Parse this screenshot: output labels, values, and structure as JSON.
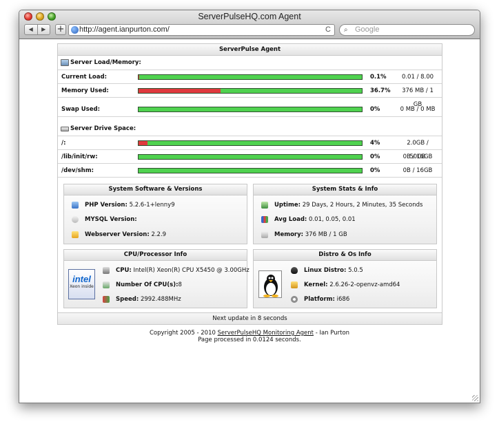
{
  "window": {
    "title": "ServerPulseHQ.com Agent"
  },
  "toolbar": {
    "back": "◀",
    "forward": "▶",
    "new_tab": "+"
  },
  "address_bar": {
    "url": "http://agent.ianpurton.com/",
    "reload": "C"
  },
  "search_bar": {
    "placeholder": "Google"
  },
  "panel": {
    "title": "ServerPulse Agent",
    "load_section": "Server Load/Memory:",
    "rows": [
      {
        "label": "Current Load:",
        "percent": "0.1%",
        "amount": "0.01 / 8.00",
        "fraction": 0.001
      },
      {
        "label": "Memory Used:",
        "percent": "36.7%",
        "amount": "376 MB / 1 GB",
        "fraction": 0.367
      },
      {
        "label": "Swap Used:",
        "percent": "0%",
        "amount": "0 MB / 0 MB",
        "fraction": 0
      }
    ],
    "drive_section": "Server Drive Space:",
    "drives": [
      {
        "label": "/:",
        "percent": "4%",
        "amount": "2.0GB / 50GB",
        "fraction": 0.04
      },
      {
        "label": "/lib/init/rw:",
        "percent": "0%",
        "amount": "0B / 16GB",
        "fraction": 0
      },
      {
        "label": "/dev/shm:",
        "percent": "0%",
        "amount": "0B / 16GB",
        "fraction": 0
      }
    ],
    "software": {
      "title": "System Software & Versions",
      "items": [
        {
          "label": "PHP Version:",
          "value": "5.2.6-1+lenny9"
        },
        {
          "label": "MYSQL Version:",
          "value": ""
        },
        {
          "label": "Webserver Version:",
          "value": "2.2.9"
        }
      ]
    },
    "stats": {
      "title": "System Stats & Info",
      "items": [
        {
          "label": "Uptime:",
          "value": "29 Days, 2 Hours, 2 Minutes, 35 Seconds"
        },
        {
          "label": "Avg Load:",
          "value": "0.01, 0.05, 0.01"
        },
        {
          "label": "Memory:",
          "value": "376 MB / 1 GB"
        }
      ]
    },
    "cpu": {
      "title": "CPU/Processor Info",
      "logo_text": "intel",
      "logo_sub": "Xeon inside",
      "items": [
        {
          "label": "CPU:",
          "value": "Intel(R) Xeon(R) CPU X5450 @ 3.00GHz"
        },
        {
          "label": "Number Of CPU(s):",
          "value": "8"
        },
        {
          "label": "Speed:",
          "value": "2992.488MHz"
        }
      ]
    },
    "distro": {
      "title": "Distro & Os Info",
      "items": [
        {
          "label": "Linux Distro:",
          "value": "5.0.5"
        },
        {
          "label": "Kernel:",
          "value": "2.6.26-2-openvz-amd64"
        },
        {
          "label": "Platform:",
          "value": "i686"
        }
      ]
    },
    "footer": "Next update in 8 seconds"
  },
  "copyright": {
    "prefix": "Copyright 2005 - 2010",
    "link": "ServerPulseHQ Monitoring Agent",
    "suffix": "- Ian Purton",
    "processed": "Page processed in 0.0124 seconds."
  },
  "colors": {
    "bar_ok": "#4fd24f",
    "bar_used": "#e0393e"
  }
}
